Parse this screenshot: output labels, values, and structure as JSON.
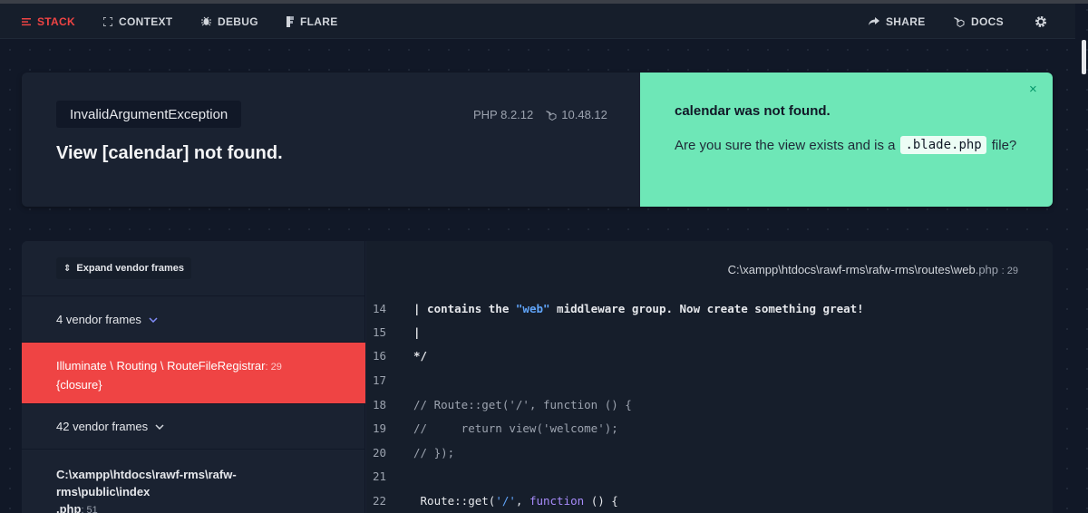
{
  "nav": {
    "stack": "STACK",
    "context": "CONTEXT",
    "debug": "DEBUG",
    "flare": "FLARE",
    "share": "SHARE",
    "docs": "DOCS"
  },
  "error": {
    "exception_class": "InvalidArgumentException",
    "message": "View [calendar] not found.",
    "php_version": "PHP 8.2.12",
    "laravel_version": "10.48.12"
  },
  "solution": {
    "title": "calendar was not found.",
    "text_before": "Are you sure the view exists and is a",
    "code": ".blade.php",
    "text_after": "file?",
    "close_glyph": "×"
  },
  "frames": {
    "expand_label": "Expand vendor frames",
    "vendor_group_1": "4 vendor frames",
    "active_class": "Illuminate \\ Routing \\ RouteFileRegistrar",
    "active_line": ": 29",
    "active_method": "{closure}",
    "vendor_group_2": "42 vendor frames",
    "app_frame_path_1": "C:\\xampp\\htdocs\\rawf-rms\\rafw-",
    "app_frame_path_2": "rms\\public\\index",
    "app_frame_path_3": ".php",
    "app_frame_line": ": 51"
  },
  "code": {
    "file_path": "C:\\xampp\\htdocs\\rawf-rms\\rafw-rms\\routes\\web",
    "file_ext": ".php",
    "file_line": ": 29",
    "lines": [
      {
        "n": "14",
        "pre": "| contains the ",
        "str": "\"web\"",
        "post": " middleware group. Now create something great!"
      },
      {
        "n": "15",
        "text": "|"
      },
      {
        "n": "16",
        "text": "*/"
      },
      {
        "n": "17",
        "text": ""
      },
      {
        "n": "18",
        "text": "// Route::get('/', function () {"
      },
      {
        "n": "19",
        "text": "//     return view('welcome');"
      },
      {
        "n": "20",
        "text": "// });"
      },
      {
        "n": "21",
        "text": ""
      },
      {
        "n": "22",
        "pre": " Route::get(",
        "str": "'/'",
        "mid": ", ",
        "kw": "function",
        "post": " () {"
      }
    ]
  }
}
